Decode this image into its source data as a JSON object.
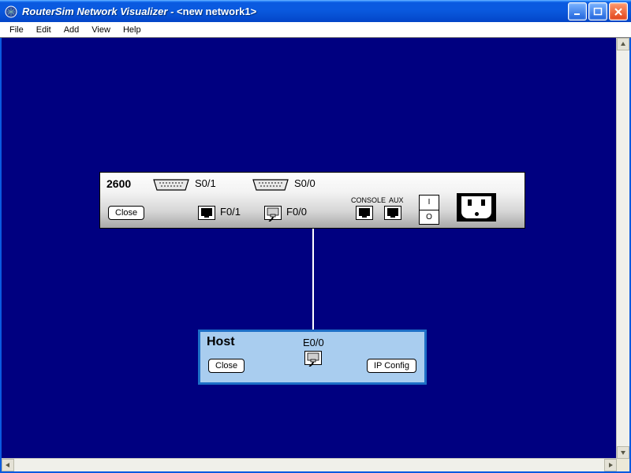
{
  "window": {
    "app_title": "RouterSim Network Visualizer",
    "doc_title": "<new network1>"
  },
  "menu": {
    "file": "File",
    "edit": "Edit",
    "add": "Add",
    "view": "View",
    "help": "Help"
  },
  "router": {
    "model": "2600",
    "close": "Close",
    "s01": "S0/1",
    "s00": "S0/0",
    "f01": "F0/1",
    "f00": "F0/0",
    "console": "CONSOLE",
    "aux": "AUX",
    "switch_on": "I",
    "switch_off": "O"
  },
  "host": {
    "label": "Host",
    "close": "Close",
    "e00": "E0/0",
    "ipconfig": "IP Config"
  }
}
